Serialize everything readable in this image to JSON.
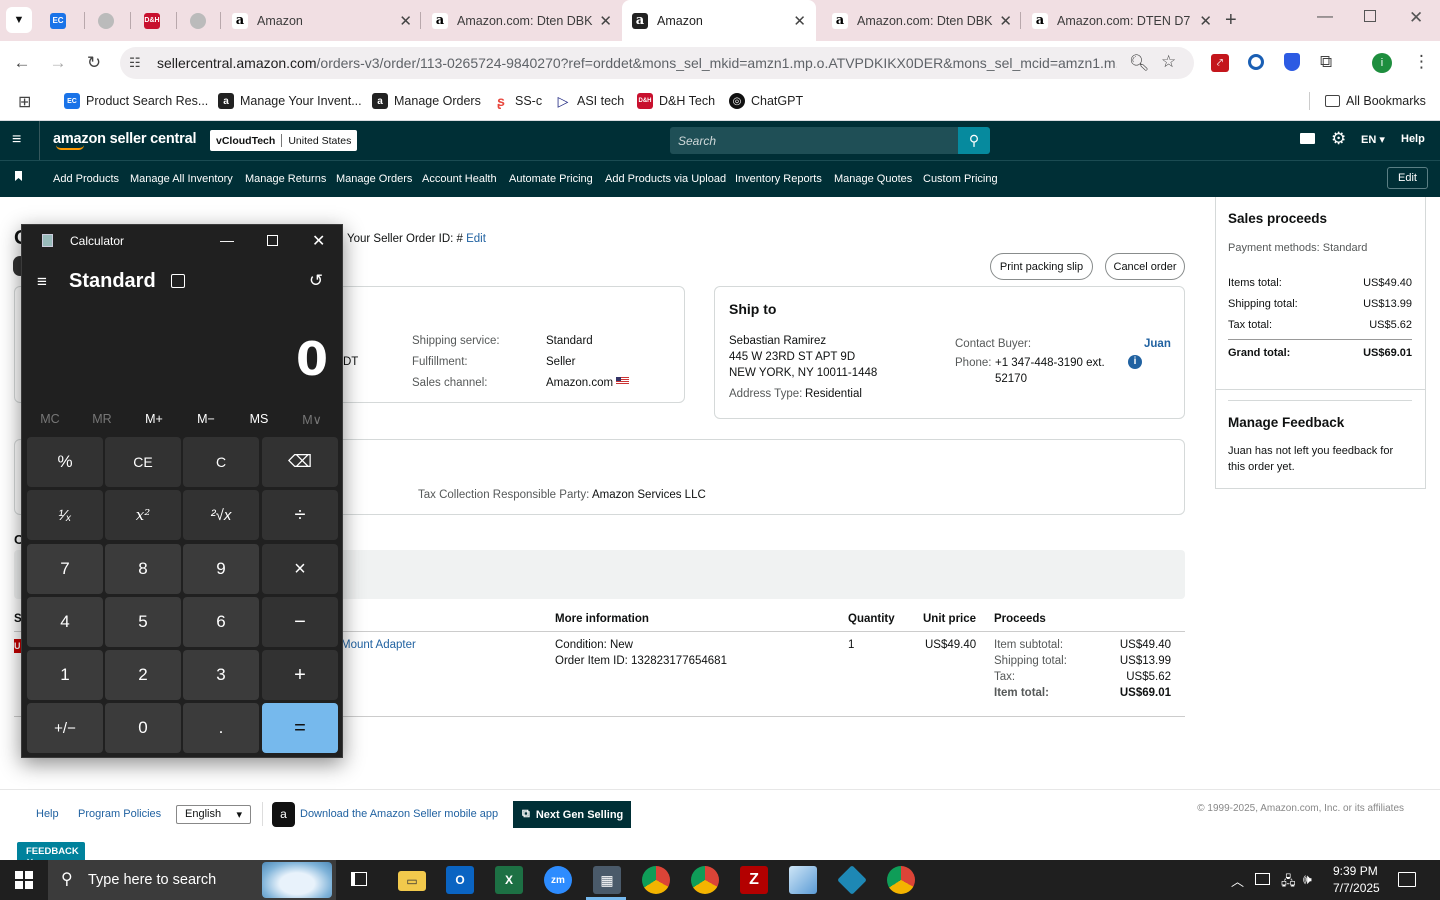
{
  "browser": {
    "tabs": [
      {
        "title": "",
        "icon": "ec-icon"
      },
      {
        "title": "",
        "icon": "generic-icon"
      },
      {
        "title": "",
        "icon": "dh-icon"
      },
      {
        "title": "",
        "icon": "generic-icon"
      },
      {
        "title": "Amazon",
        "icon": "amazon-icon"
      },
      {
        "title": "Amazon.com: Dten DBK",
        "icon": "amazon-icon"
      },
      {
        "title": "Amazon",
        "icon": "amazon-icon",
        "active": true
      },
      {
        "title": "Amazon.com: Dten DBK",
        "icon": "amazon-icon"
      },
      {
        "title": "Amazon.com: DTEN D7 7",
        "icon": "amazon-icon"
      }
    ],
    "url_domain": "sellercentral.amazon.com",
    "url_path": "/orders-v3/order/113-0265724-9840270?ref=orddet&mons_sel_mkid=amzn1.mp.o.ATVPDKIKX0DER&mons_sel_mcid=amzn1.m...",
    "profile_initial": "i",
    "bookmarks": [
      {
        "label": "Product Search Res...",
        "icon": "ec-icon"
      },
      {
        "label": "Manage Your Invent...",
        "icon": "amazon-icon"
      },
      {
        "label": "Manage Orders",
        "icon": "amazon-icon"
      },
      {
        "label": "SS-c",
        "icon": "swirl-icon"
      },
      {
        "label": "ASI tech",
        "icon": "asi-icon"
      },
      {
        "label": "D&H Tech",
        "icon": "dh-icon"
      },
      {
        "label": "ChatGPT",
        "icon": "chatgpt-icon"
      }
    ],
    "all_bookmarks": "All Bookmarks"
  },
  "sc": {
    "logo": "amazon seller central",
    "store": "vCloudTech",
    "marketplace": "United States",
    "search_placeholder": "Search",
    "lang": "EN",
    "help": "Help",
    "nav": [
      "Add Products",
      "Manage All Inventory",
      "Manage Returns",
      "Manage Orders",
      "Account Health",
      "Automate Pricing",
      "Add Products via Upload",
      "Inventory Reports",
      "Manage Quotes",
      "Custom Pricing"
    ],
    "edit": "Edit"
  },
  "order": {
    "seller_order_label": "Your Seller Order ID: #",
    "seller_order_edit": "Edit",
    "print_slip": "Print packing slip",
    "cancel_order": "Cancel order",
    "partial_letter_1": "O",
    "partial_dt": "DT",
    "shipping_service_label": "Shipping service:",
    "shipping_service": "Standard",
    "fulfillment_label": "Fulfillment:",
    "fulfillment": "Seller",
    "sales_channel_label": "Sales channel:",
    "sales_channel": "Amazon.com",
    "ship_to_title": "Ship to",
    "ship_name": "Sebastian Ramirez",
    "ship_addr1": "445 W 23RD ST APT 9D",
    "ship_addr2": "NEW YORK, NY 10011-1448",
    "address_type_label": "Address Type:",
    "address_type": "Residential",
    "contact_label": "Contact Buyer:",
    "contact_name": "Juan",
    "phone_label": "Phone:",
    "phone": "+1 347-448-3190 ext.",
    "phone_ext": "52170",
    "tax_party_label": "Tax Collection Responsible Party:",
    "tax_party": "Amazon Services LLC",
    "partial_letter_2": "O",
    "partial_letter_3": "S",
    "partial_letter_4": "U",
    "col_more": "More information",
    "col_qty": "Quantity",
    "col_unit": "Unit price",
    "col_proceeds": "Proceeds",
    "item_title_partial": "Mount Adapter",
    "condition": "Condition: New",
    "order_item_id": "Order Item ID: 132823177654681",
    "qty": "1",
    "unit_price": "US$49.40",
    "item_subtotal_label": "Item subtotal:",
    "item_subtotal": "US$49.40",
    "item_shipping_label": "Shipping total:",
    "item_shipping": "US$13.99",
    "item_tax_label": "Tax:",
    "item_tax": "US$5.62",
    "item_total_label": "Item total:",
    "item_total": "US$69.01"
  },
  "proceeds": {
    "title": "Sales proceeds",
    "payment": "Payment methods: Standard",
    "items_label": "Items total:",
    "items": "US$49.40",
    "shipping_label": "Shipping total:",
    "shipping": "US$13.99",
    "tax_label": "Tax total:",
    "tax": "US$5.62",
    "grand_label": "Grand total:",
    "grand": "US$69.01",
    "feedback_title": "Manage Feedback",
    "feedback_text_1": "Juan has not left you feedback for",
    "feedback_text_2": "this order yet."
  },
  "footer": {
    "help": "Help",
    "policies": "Program Policies",
    "language": "English",
    "app": "Download the Amazon Seller mobile app",
    "next_gen": "Next Gen Selling",
    "copyright": "© 1999-2025, Amazon.com, Inc. or its affiliates",
    "feedback": "FEEDBACK"
  },
  "calculator": {
    "title": "Calculator",
    "mode": "Standard",
    "display": "0",
    "memory": [
      "MC",
      "MR",
      "M+",
      "M−",
      "MS",
      "M∨"
    ],
    "buttons": [
      [
        "%",
        "CE",
        "C",
        "⌫"
      ],
      [
        "¹⁄ₓ",
        "x²",
        "²√x",
        "÷"
      ],
      [
        "7",
        "8",
        "9",
        "×"
      ],
      [
        "4",
        "5",
        "6",
        "−"
      ],
      [
        "1",
        "2",
        "3",
        "+"
      ],
      [
        "+/−",
        "0",
        ".",
        "="
      ]
    ]
  },
  "taskbar": {
    "search_placeholder": "Type here to search",
    "time": "9:39 PM",
    "date": "7/7/2025"
  }
}
